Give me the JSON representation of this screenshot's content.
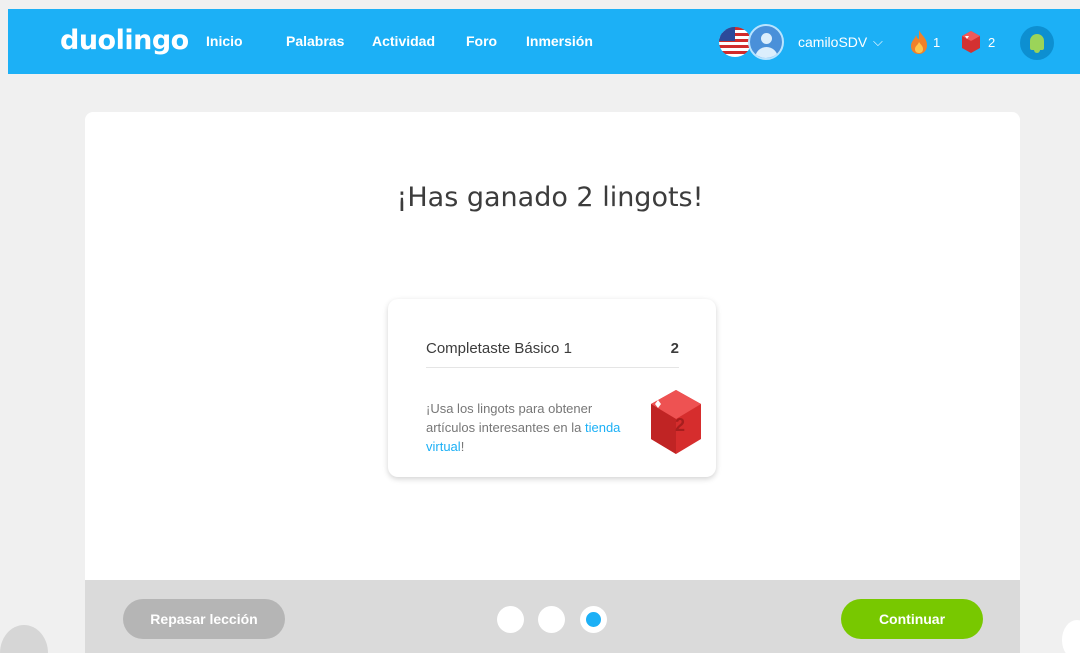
{
  "topbar": {
    "logo": "duolingo",
    "nav": [
      "Inicio",
      "Palabras",
      "Actividad",
      "Foro",
      "Inmersión"
    ],
    "username": "camiloSDV",
    "streak": "1",
    "lingots": "2",
    "colors": {
      "bar": "#1cb0f6",
      "streak": "#f0812a",
      "lingot": "#d33131",
      "notification": "#9bd459"
    }
  },
  "main": {
    "headline": "¡Has ganado 2 lingots!",
    "reward": {
      "label": "Completaste Básico 1",
      "amount": "2",
      "message": "¡Usa los lingots para obtener artículos interesantes en la ",
      "link": "tienda virtual",
      "message_end": "!",
      "gem_value": "2",
      "gem_icon": "lingot-gem-icon"
    }
  },
  "footer": {
    "review_label": "Repasar lección",
    "continue_label": "Continuar",
    "progress": {
      "total": 3,
      "current": 3
    },
    "colors": {
      "continue": "#78c800",
      "review": "#b5b5b5",
      "active_dot": "#1cb0f6"
    }
  }
}
